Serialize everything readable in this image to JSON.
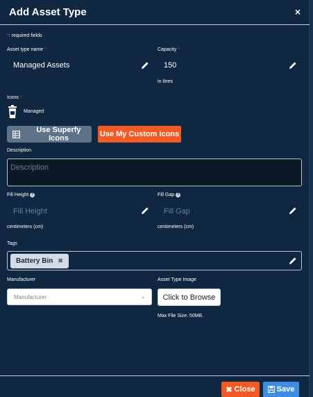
{
  "dialog": {
    "title": "Add Asset Type",
    "close_glyph": "×"
  },
  "required_note": {
    "star": "*",
    "text": ": required fields"
  },
  "asset_type_name": {
    "label": "Asset type name",
    "value": "Managed Assets"
  },
  "capacity": {
    "label": "Capacity",
    "value": "150",
    "unit": "in litres"
  },
  "icons": {
    "label": "Icons",
    "selected_name": "Managed",
    "superfy_button": "Use Superfy Icons",
    "custom_button": "Use My Custom Icons"
  },
  "description": {
    "label": "Description",
    "placeholder": "Description"
  },
  "fill_height": {
    "label": "Fill Height",
    "placeholder": "Fill Height",
    "unit": "centimeters (cm)"
  },
  "fill_gap": {
    "label": "Fill Gap",
    "placeholder": "Fill Gap",
    "unit": "centimeters (cm)"
  },
  "tags": {
    "label": "Tags",
    "items": [
      "Battery Bin"
    ]
  },
  "manufacturer": {
    "label": "Manufacturer",
    "placeholder": "Manufacturer"
  },
  "asset_type_image": {
    "label": "Asset Type Image",
    "browse_button": "Click to Browse",
    "max_size_note": "Max File Size: 50MB."
  },
  "footer": {
    "close_label": "Close",
    "save_label": "Save"
  },
  "colors": {
    "modal_bg": "#0f2740",
    "accent_orange": "#f15a24",
    "accent_blue": "#3e8de0",
    "required_red": "#e0453a"
  },
  "icon_names": [
    "close-icon",
    "pencil-icon",
    "bin-icon",
    "grid-icon",
    "chevron-down-icon",
    "times-icon",
    "save-icon",
    "help-icon"
  ]
}
